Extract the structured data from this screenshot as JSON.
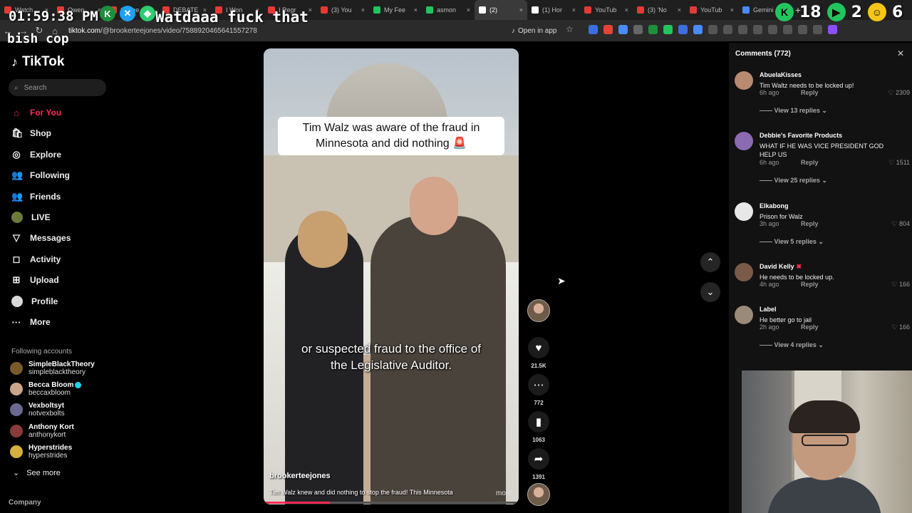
{
  "browser": {
    "tabs": [
      {
        "label": "Watch",
        "color": "#e53935"
      },
      {
        "label": "Owen",
        "color": "#e53935"
      },
      {
        "label": "Coffee",
        "color": "#e53935"
      },
      {
        "label": "DEBATE",
        "color": "#e53935"
      },
      {
        "label": "I Won",
        "color": "#e53935"
      },
      {
        "label": "I Regr",
        "color": "#e53935"
      },
      {
        "label": "(3) You",
        "color": "#e53935"
      },
      {
        "label": "My Fee",
        "color": "#21c55d"
      },
      {
        "label": "asmon",
        "color": "#21c55d"
      },
      {
        "label": "(2)",
        "color": "#ffffff"
      },
      {
        "label": "(1) Hor",
        "color": "#ffffff"
      },
      {
        "label": "YouTub",
        "color": "#e53935"
      },
      {
        "label": "(3) 'No",
        "color": "#e53935"
      },
      {
        "label": "YouTub",
        "color": "#e53935"
      },
      {
        "label": "Gemini",
        "color": "#4a8cff"
      }
    ],
    "url_host": "tiktok.com",
    "url_path": "/@brookerteejones/video/7588920465641557278",
    "open_in_app": "Open in app"
  },
  "overlay": {
    "clock": "01:59:38 PM",
    "shout": "Watdaaa  fuck that",
    "shout2": "bish cop",
    "counter1": "18",
    "counter2": "2",
    "counter3": "6"
  },
  "sidebar": {
    "logo": "TikTok",
    "search_placeholder": "Search",
    "items": [
      {
        "label": "For You",
        "icon": "⌂"
      },
      {
        "label": "Shop",
        "icon": "🛍"
      },
      {
        "label": "Explore",
        "icon": "◎"
      },
      {
        "label": "Following",
        "icon": "👥"
      },
      {
        "label": "Friends",
        "icon": "👥"
      },
      {
        "label": "LIVE",
        "icon": ""
      },
      {
        "label": "Messages",
        "icon": "▽"
      },
      {
        "label": "Activity",
        "icon": "◻"
      },
      {
        "label": "Upload",
        "icon": "⊞"
      },
      {
        "label": "Profile",
        "icon": ""
      },
      {
        "label": "More",
        "icon": "···"
      }
    ],
    "following_heading": "Following accounts",
    "accounts": [
      {
        "name": "SimpleBlackTheory",
        "handle": "simpleblacktheory"
      },
      {
        "name": "Becca Bloom",
        "handle": "beccaxbloom"
      },
      {
        "name": "Vexboltsyt",
        "handle": "notvexbolts"
      },
      {
        "name": "Anthony Kort",
        "handle": "anthonykort"
      },
      {
        "name": "Hyperstrides",
        "handle": "hyperstrides"
      }
    ],
    "see_more": "See more",
    "company": "Company"
  },
  "video": {
    "caption": "Tim Walz was aware of the fraud in Minnesota and did nothing 🚨",
    "subtitle": "or suspected fraud to the office of the Legislative Auditor.",
    "author": "brookerteejones",
    "description": "Tim Walz knew and did nothing to stop the fraud! This Minnesota",
    "more": "more",
    "progress_fraction": 0.26
  },
  "actions": {
    "likes": "21.5K",
    "comments": "772",
    "saves": "1063",
    "shares": "1391"
  },
  "comments_panel": {
    "title": "Comments (772)",
    "comments": [
      {
        "name": "AbuelaKisses",
        "text": "Tim Waltz needs to be locked up!",
        "time": "6h ago",
        "reply": "Reply",
        "likes": "2309",
        "view": "View 13 replies"
      },
      {
        "name": "Debbie's Favorite Products",
        "text": "WHAT IF HE WAS VICE PRESIDENT GOD HELP US",
        "time": "6h ago",
        "reply": "Reply",
        "likes": "1511",
        "view": "View 25 replies"
      },
      {
        "name": "Elkabong",
        "text": "Prison for Walz",
        "time": "3h ago",
        "reply": "Reply",
        "likes": "804",
        "view": "View 5 replies"
      },
      {
        "name": "David Kelly",
        "text": "He needs to be locked up.",
        "time": "4h ago",
        "reply": "Reply",
        "likes": "166",
        "view": ""
      },
      {
        "name": "Label",
        "text": "He better go to jail",
        "time": "2h ago",
        "reply": "Reply",
        "likes": "166",
        "view": "View 4 replies"
      }
    ]
  },
  "colors": {
    "accent": "#fe2c55",
    "background": "#000000",
    "panel": "#121212"
  }
}
